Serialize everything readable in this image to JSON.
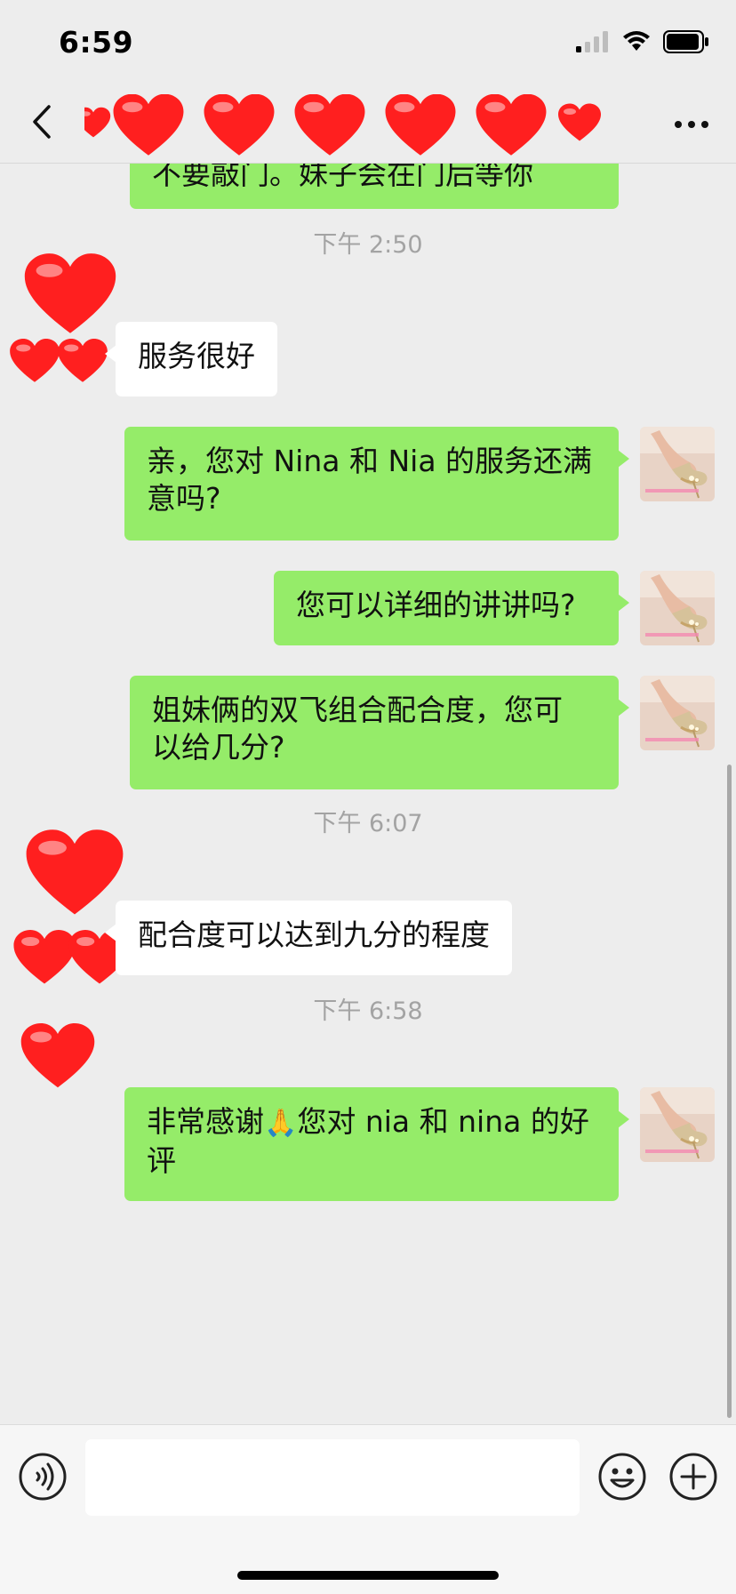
{
  "status_bar": {
    "time": "6:59"
  },
  "nav": {
    "title": ""
  },
  "chat": {
    "top_partial_text": "不要敲门。妹子会在门后等你",
    "times": [
      "下午 2:50",
      "下午 6:07",
      "下午 6:58"
    ],
    "messages": [
      {
        "from": "them",
        "text": "服务很好"
      },
      {
        "from": "me",
        "lines": [
          "亲，您对 Nina 和 Nia 的服务还满",
          "意吗?"
        ]
      },
      {
        "from": "me",
        "text": "您可以详细的讲讲吗?"
      },
      {
        "from": "me",
        "lines": [
          "姐妹俩的双飞组合配合度，您可",
          "以给几分?"
        ]
      },
      {
        "from": "them",
        "text": "配合度可以达到九分的程度"
      },
      {
        "from": "me",
        "line1_a": "非常感谢",
        "line1_emoji": "🙏",
        "line1_b": "您对 nia 和 nina 的好",
        "line2": "评"
      }
    ]
  },
  "input": {
    "value": "",
    "placeholder": ""
  },
  "icons": {
    "back": "back-chevron-icon",
    "more": "more-dots-icon",
    "voice": "voice-icon",
    "emoji": "emoji-icon",
    "plus": "plus-icon",
    "signal": "signal-icon",
    "wifi": "wifi-icon",
    "battery": "battery-icon"
  },
  "colors": {
    "background": "#ededed",
    "my_bubble": "#95ec69",
    "their_bubble": "#ffffff",
    "heart": "#ff1f1f",
    "timestamp": "#a3a3a3"
  }
}
